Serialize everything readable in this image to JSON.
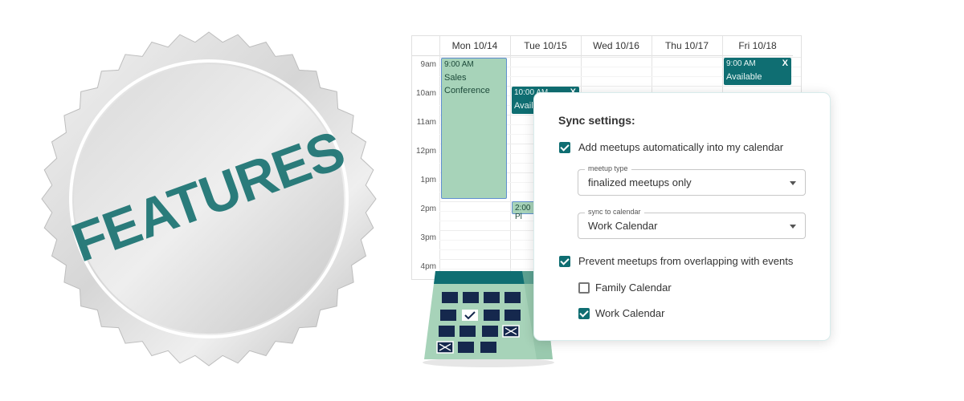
{
  "seal": {
    "stamp_text": "FEATURES",
    "stamp_color": "#16706f"
  },
  "calendar": {
    "days": [
      "Mon 10/14",
      "Tue 10/15",
      "Wed 10/16",
      "Thu 10/17",
      "Fri 10/18"
    ],
    "hours": [
      "9am",
      "10am",
      "11am",
      "12pm",
      "1pm",
      "2pm",
      "3pm",
      "4pm"
    ],
    "events": [
      {
        "day": "Mon 10/14",
        "time": "9:00 AM",
        "title": "Sales Conference",
        "style": "light"
      },
      {
        "day": "Tue 10/15",
        "time": "10:00 AM",
        "title": "Availa",
        "style": "dark",
        "close": "X"
      },
      {
        "day": "Tue 10/15",
        "time": "2:00 Pl",
        "title": "",
        "style": "light"
      },
      {
        "day": "Fri 10/18",
        "time": "9:00 AM",
        "title": "Available",
        "style": "dark",
        "close": "X"
      }
    ],
    "accent": "#0f6e72",
    "event_light": "#a7d3b9"
  },
  "sync": {
    "title": "Sync settings:",
    "add_meetups": {
      "label": "Add meetups automatically into my calendar",
      "checked": true
    },
    "meetup_type": {
      "legend": "meetup type",
      "value": "finalized meetups only"
    },
    "sync_to": {
      "legend": "sync to calendar",
      "value": "Work Calendar"
    },
    "prevent": {
      "label": "Prevent meetups from overlapping with events",
      "checked": true
    },
    "calendars": [
      {
        "label": "Family Calendar",
        "checked": false
      },
      {
        "label": "Work Calendar",
        "checked": true
      }
    ]
  },
  "desk_calendar_icon": {
    "name": "desk-calendar-icon",
    "colors": {
      "base": "#a7d3b9",
      "header": "#0f6e72",
      "cells": "#15284d"
    }
  }
}
